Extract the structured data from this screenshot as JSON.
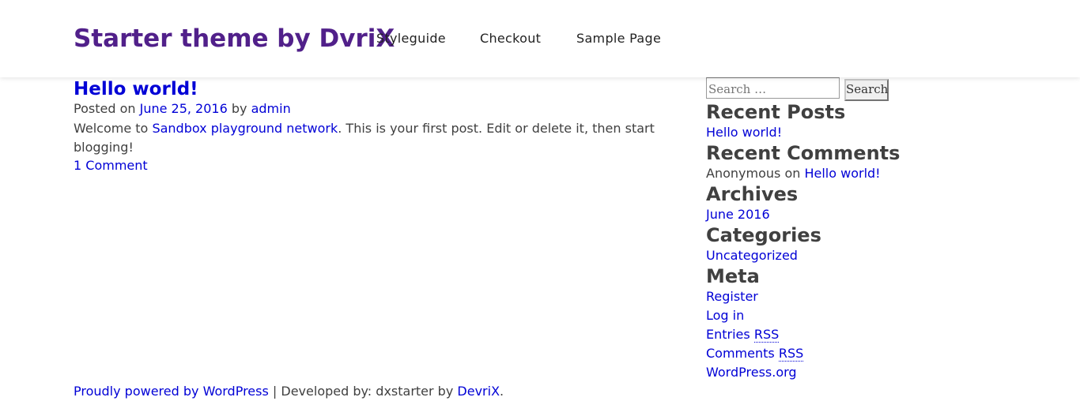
{
  "header": {
    "site_title": "Starter theme by DvriX",
    "nav": [
      "Styleguide",
      "Checkout",
      "Sample Page"
    ]
  },
  "post": {
    "title": "Hello world!",
    "posted_on_label": "Posted on",
    "date": "June 25, 2016",
    "by_label": "by",
    "author": "admin",
    "content_prefix": "Welcome to",
    "content_link": "Sandbox playground network",
    "content_suffix": ". This is your first post. Edit or delete it, then start blogging!",
    "comments_link": "1 Comment"
  },
  "sidebar": {
    "search": {
      "placeholder": "Search …",
      "button": "Search"
    },
    "recent_posts": {
      "title": "Recent Posts",
      "items": [
        "Hello world!"
      ]
    },
    "recent_comments": {
      "title": "Recent Comments",
      "author": "Anonymous",
      "on_label": "on",
      "post": "Hello world!"
    },
    "archives": {
      "title": "Archives",
      "items": [
        "June 2016"
      ]
    },
    "categories": {
      "title": "Categories",
      "items": [
        "Uncategorized"
      ]
    },
    "meta": {
      "title": "Meta",
      "register": "Register",
      "login": "Log in",
      "entries": "Entries",
      "comments": "Comments",
      "rss": "RSS",
      "wordpress": "WordPress.org"
    }
  },
  "footer": {
    "powered": "Proudly powered by WordPress",
    "separator": "|",
    "developed_by": "Developed by: dxstarter by",
    "devrix": "DevriX",
    "period": "."
  }
}
